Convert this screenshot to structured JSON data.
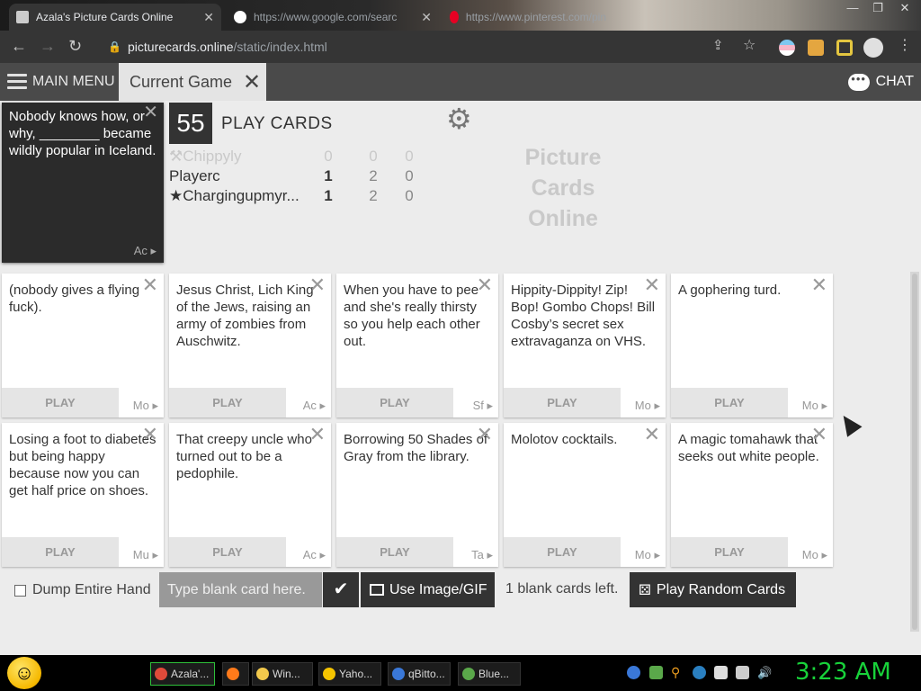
{
  "browser": {
    "tabs": [
      {
        "title": "Azala's Picture Cards Online"
      },
      {
        "title": "https://www.google.com/searc"
      },
      {
        "title": "https://www.pinterest.com/pin"
      }
    ],
    "url_host": "picturecards.online",
    "url_path": "/static/index.html"
  },
  "app": {
    "main_menu_label": "MAIN MENU",
    "current_tab_label": "Current Game",
    "chat_label": "CHAT",
    "black_card": {
      "text": "Nobody knows how, or why, ________ became wildly popular in Iceland.",
      "author": "Ac"
    },
    "play_count": "55",
    "play_cards_label": "PLAY CARDS",
    "brand": [
      "Picture",
      "Cards",
      "Online"
    ],
    "players": [
      {
        "name": "Chippyly",
        "a": "0",
        "b": "0",
        "c": "0",
        "icon": "gavel-icon",
        "dim": true
      },
      {
        "name": "Playerc",
        "a": "1",
        "b": "2",
        "c": "0",
        "icon": "",
        "dim": false
      },
      {
        "name": "Chargingupmyr...",
        "a": "1",
        "b": "2",
        "c": "0",
        "icon": "star-icon",
        "dim": false
      }
    ],
    "hand": [
      {
        "text": "(nobody gives a flying fuck).",
        "play": "PLAY",
        "author": "Mo"
      },
      {
        "text": "Jesus Christ, Lich King of the Jews, raising an army of zombies from Auschwitz.",
        "play": "PLAY",
        "author": "Ac"
      },
      {
        "text": "When you have to pee and she's really thirsty so you help each other out.",
        "play": "PLAY",
        "author": "Sf"
      },
      {
        "text": "Hippity-Dippity! Zip! Bop! Gombo Chops! Bill Cosby’s secret sex extravaganza on VHS.",
        "play": "PLAY",
        "author": "Mo"
      },
      {
        "text": "A gophering turd.",
        "play": "PLAY",
        "author": "Mo"
      },
      {
        "text": "Losing a foot to diabetes but being happy because now you can get half price on shoes.",
        "play": "PLAY",
        "author": "Mu"
      },
      {
        "text": "That creepy uncle who turned out to be a pedophile.",
        "play": "PLAY",
        "author": "Ac"
      },
      {
        "text": "Borrowing 50 Shades of Gray from the library.",
        "play": "PLAY",
        "author": "Ta"
      },
      {
        "text": "Molotov cocktails.",
        "play": "PLAY",
        "author": "Mo"
      },
      {
        "text": "A magic tomahawk that seeks out white people.",
        "play": "PLAY",
        "author": "Mo"
      }
    ],
    "dump_label": "Dump Entire Hand",
    "blank_placeholder": "Type blank card here.",
    "image_btn_label": "Use Image/GIF",
    "blank_left": "1 blank cards left.",
    "random_btn_label": "Play Random Cards"
  },
  "taskbar": {
    "items": [
      {
        "label": "Azala'...",
        "color": "#e04a3a",
        "active": true
      },
      {
        "label": "",
        "color": "#ff7a1a",
        "active": false
      },
      {
        "label": "Win...",
        "color": "#f2c94c",
        "active": false
      },
      {
        "label": "Yaho...",
        "color": "#f5c400",
        "active": false
      },
      {
        "label": "qBitto...",
        "color": "#3a78d8",
        "active": false
      },
      {
        "label": "Blue...",
        "color": "#5aa84a",
        "active": false
      }
    ],
    "clock": "3:23 AM"
  },
  "colors": {
    "accent_dark": "#333333",
    "nav_bg": "#4a4a4a",
    "clock": "#18d23a"
  }
}
